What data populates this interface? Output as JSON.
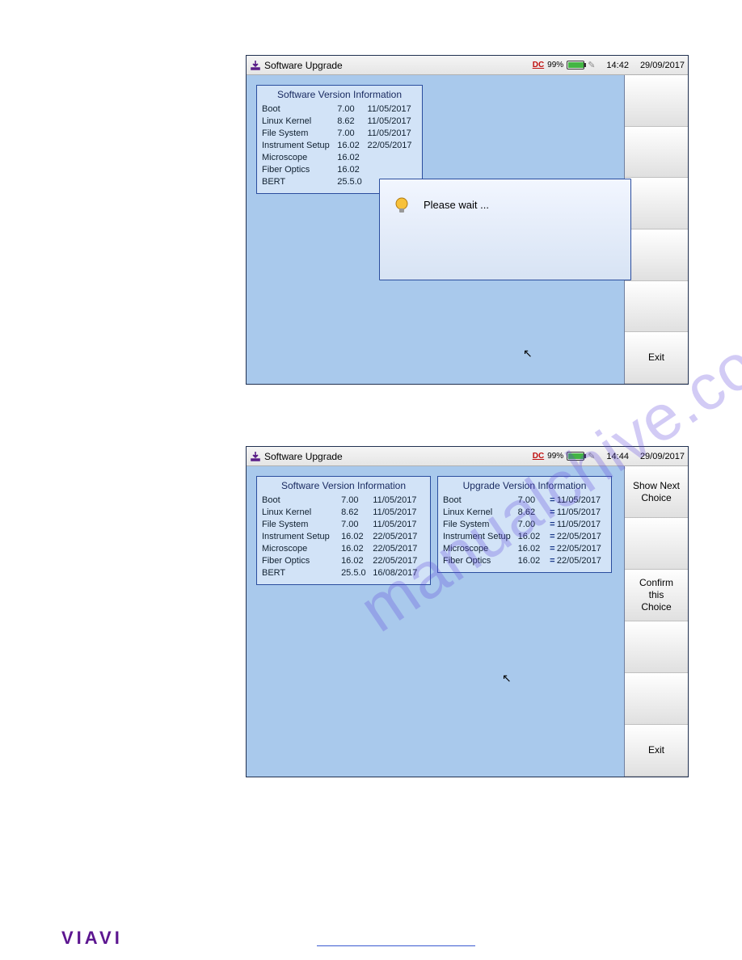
{
  "watermark": "manualchive.com",
  "logo": "VIAVI",
  "screenshot1": {
    "title": "Software Upgrade",
    "status": {
      "dc": "DC",
      "battery_pct": "99%",
      "time": "14:42",
      "date": "29/09/2017"
    },
    "panel_title": "Software Version Information",
    "rows": [
      {
        "name": "Boot",
        "ver": "7.00",
        "date": "11/05/2017"
      },
      {
        "name": "Linux Kernel",
        "ver": "8.62",
        "date": "11/05/2017"
      },
      {
        "name": "File System",
        "ver": "7.00",
        "date": "11/05/2017"
      },
      {
        "name": "Instrument Setup",
        "ver": "16.02",
        "date": "22/05/2017"
      },
      {
        "name": "Microscope",
        "ver": "16.02",
        "date": ""
      },
      {
        "name": "Fiber Optics",
        "ver": "16.02",
        "date": ""
      },
      {
        "name": "BERT",
        "ver": "25.5.0",
        "date": ""
      }
    ],
    "dialog": "Please wait ...",
    "exit_label": "Exit"
  },
  "screenshot2": {
    "title": "Software Upgrade",
    "status": {
      "dc": "DC",
      "battery_pct": "99%",
      "time": "14:44",
      "date": "29/09/2017"
    },
    "panel1_title": "Software Version Information",
    "panel1_rows": [
      {
        "name": "Boot",
        "ver": "7.00",
        "date": "11/05/2017"
      },
      {
        "name": "Linux Kernel",
        "ver": "8.62",
        "date": "11/05/2017"
      },
      {
        "name": "File System",
        "ver": "7.00",
        "date": "11/05/2017"
      },
      {
        "name": "Instrument Setup",
        "ver": "16.02",
        "date": "22/05/2017"
      },
      {
        "name": "Microscope",
        "ver": "16.02",
        "date": "22/05/2017"
      },
      {
        "name": "Fiber Optics",
        "ver": "16.02",
        "date": "22/05/2017"
      },
      {
        "name": "BERT",
        "ver": "25.5.0",
        "date": "16/08/2017"
      }
    ],
    "panel2_title": "Upgrade Version Information",
    "panel2_rows": [
      {
        "name": "Boot",
        "ver": "7.00",
        "date": "11/05/2017"
      },
      {
        "name": "Linux Kernel",
        "ver": "8.62",
        "date": "11/05/2017"
      },
      {
        "name": "File System",
        "ver": "7.00",
        "date": "11/05/2017"
      },
      {
        "name": "Instrument Setup",
        "ver": "16.02",
        "date": "22/05/2017"
      },
      {
        "name": "Microscope",
        "ver": "16.02",
        "date": "22/05/2017"
      },
      {
        "name": "Fiber Optics",
        "ver": "16.02",
        "date": "22/05/2017"
      }
    ],
    "btn_show_next": "Show Next\nChoice",
    "btn_confirm": "Confirm\nthis\nChoice",
    "exit_label": "Exit"
  }
}
